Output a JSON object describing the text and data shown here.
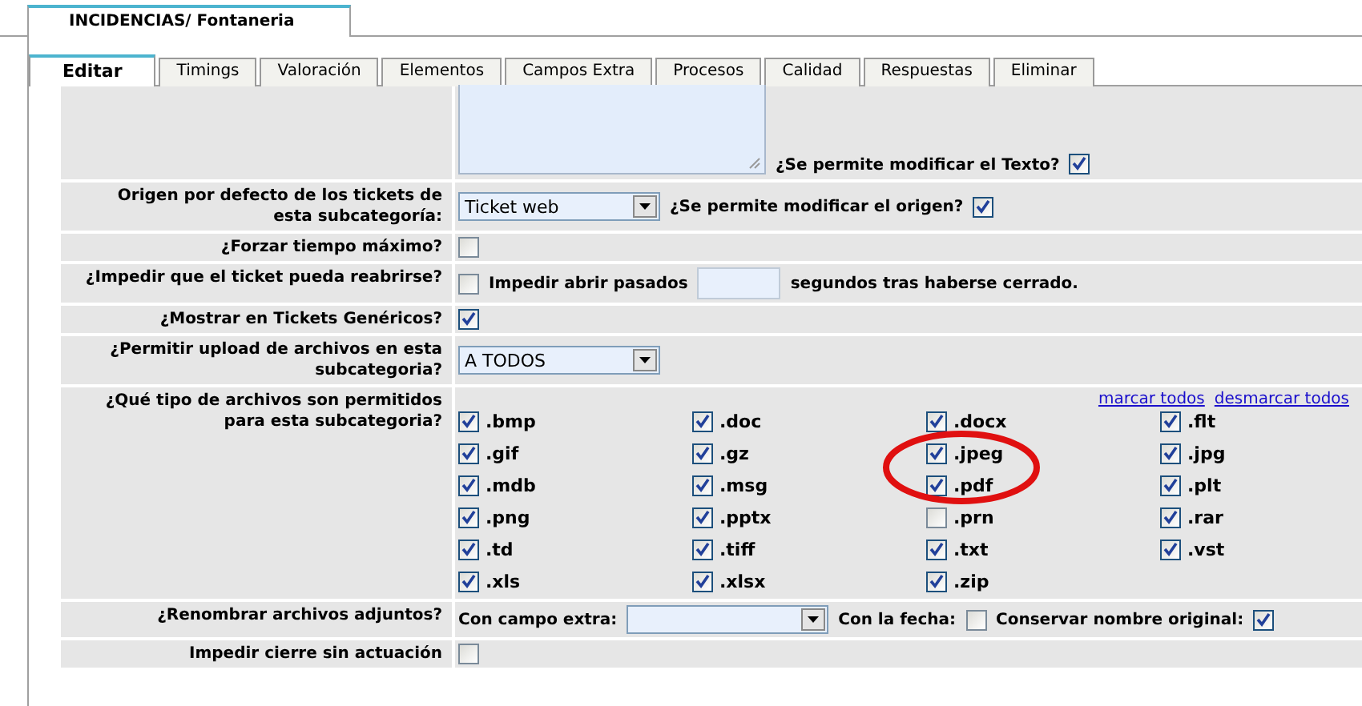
{
  "header_tab": {
    "label": "INCIDENCIAS/ Fontaneria"
  },
  "tabs": [
    {
      "label": "Editar",
      "selected": true
    },
    {
      "label": "Timings",
      "selected": false
    },
    {
      "label": "Valoración",
      "selected": false
    },
    {
      "label": "Elementos",
      "selected": false
    },
    {
      "label": "Campos Extra",
      "selected": false
    },
    {
      "label": "Procesos",
      "selected": false
    },
    {
      "label": "Calidad",
      "selected": false
    },
    {
      "label": "Respuestas",
      "selected": false
    },
    {
      "label": "Eliminar",
      "selected": false
    }
  ],
  "rows": [
    {
      "kind": "controls",
      "controls": [
        {
          "kind": "textarea"
        },
        {
          "kind": "text",
          "text": "¿Se permite modificar el Texto?"
        },
        {
          "kind": "checkbox",
          "checked": true
        }
      ]
    },
    {
      "kind": "controls",
      "label": "Origen por defecto de los tickets de esta subcategoría:",
      "controls": [
        {
          "kind": "select",
          "value": "Ticket web"
        },
        {
          "kind": "text",
          "text": "¿Se permite modificar el origen?"
        },
        {
          "kind": "checkbox",
          "checked": true
        }
      ]
    },
    {
      "kind": "controls",
      "label": "¿Forzar tiempo máximo?",
      "controls": [
        {
          "kind": "checkbox",
          "checked": false
        }
      ]
    },
    {
      "kind": "controls",
      "label": "¿Impedir que el ticket pueda reabrirse?",
      "controls": [
        {
          "kind": "checkbox",
          "checked": false
        },
        {
          "kind": "text",
          "text": "Impedir abrir pasados"
        },
        {
          "kind": "input"
        },
        {
          "kind": "text",
          "text": "segundos tras haberse cerrado."
        }
      ]
    },
    {
      "kind": "controls",
      "label": "¿Mostrar en Tickets Genéricos?",
      "controls": [
        {
          "kind": "checkbox",
          "checked": true
        }
      ]
    },
    {
      "kind": "controls",
      "label": "¿Permitir upload de archivos en esta subcategoria?",
      "controls": [
        {
          "kind": "select",
          "value": "A TODOS"
        }
      ]
    },
    {
      "kind": "filetypes",
      "label": "¿Qué tipo de archivos son permitidos para esta subcategoria?",
      "links": [
        "marcar todos",
        "desmarcar todos"
      ],
      "types": [
        {
          "ext": ".bmp",
          "checked": true
        },
        {
          "ext": ".doc",
          "checked": true
        },
        {
          "ext": ".docx",
          "checked": true
        },
        {
          "ext": ".flt",
          "checked": true
        },
        {
          "ext": ".gif",
          "checked": true
        },
        {
          "ext": ".gz",
          "checked": true
        },
        {
          "ext": ".jpeg",
          "checked": true
        },
        {
          "ext": ".jpg",
          "checked": true
        },
        {
          "ext": ".mdb",
          "checked": true
        },
        {
          "ext": ".msg",
          "checked": true
        },
        {
          "ext": ".pdf",
          "checked": true
        },
        {
          "ext": ".plt",
          "checked": true
        },
        {
          "ext": ".png",
          "checked": true
        },
        {
          "ext": ".pptx",
          "checked": true
        },
        {
          "ext": ".prn",
          "checked": false
        },
        {
          "ext": ".rar",
          "checked": true
        },
        {
          "ext": ".td",
          "checked": true
        },
        {
          "ext": ".tiff",
          "checked": true
        },
        {
          "ext": ".txt",
          "checked": true
        },
        {
          "ext": ".vst",
          "checked": true
        },
        {
          "ext": ".xls",
          "checked": true
        },
        {
          "ext": ".xlsx",
          "checked": true
        },
        {
          "ext": ".zip",
          "checked": true
        }
      ]
    },
    {
      "kind": "controls",
      "label": "¿Renombrar archivos adjuntos?",
      "controls": [
        {
          "kind": "text",
          "text": "Con campo extra:"
        },
        {
          "kind": "select"
        },
        {
          "kind": "text",
          "text": "Con la fecha:"
        },
        {
          "kind": "checkbox",
          "checked": false
        },
        {
          "kind": "text",
          "text": "Conservar nombre original:"
        },
        {
          "kind": "checkbox",
          "checked": true
        }
      ]
    },
    {
      "kind": "controls",
      "label": "Impedir cierre sin actuación",
      "controls": [
        {
          "kind": "checkbox",
          "checked": false
        }
      ]
    }
  ]
}
